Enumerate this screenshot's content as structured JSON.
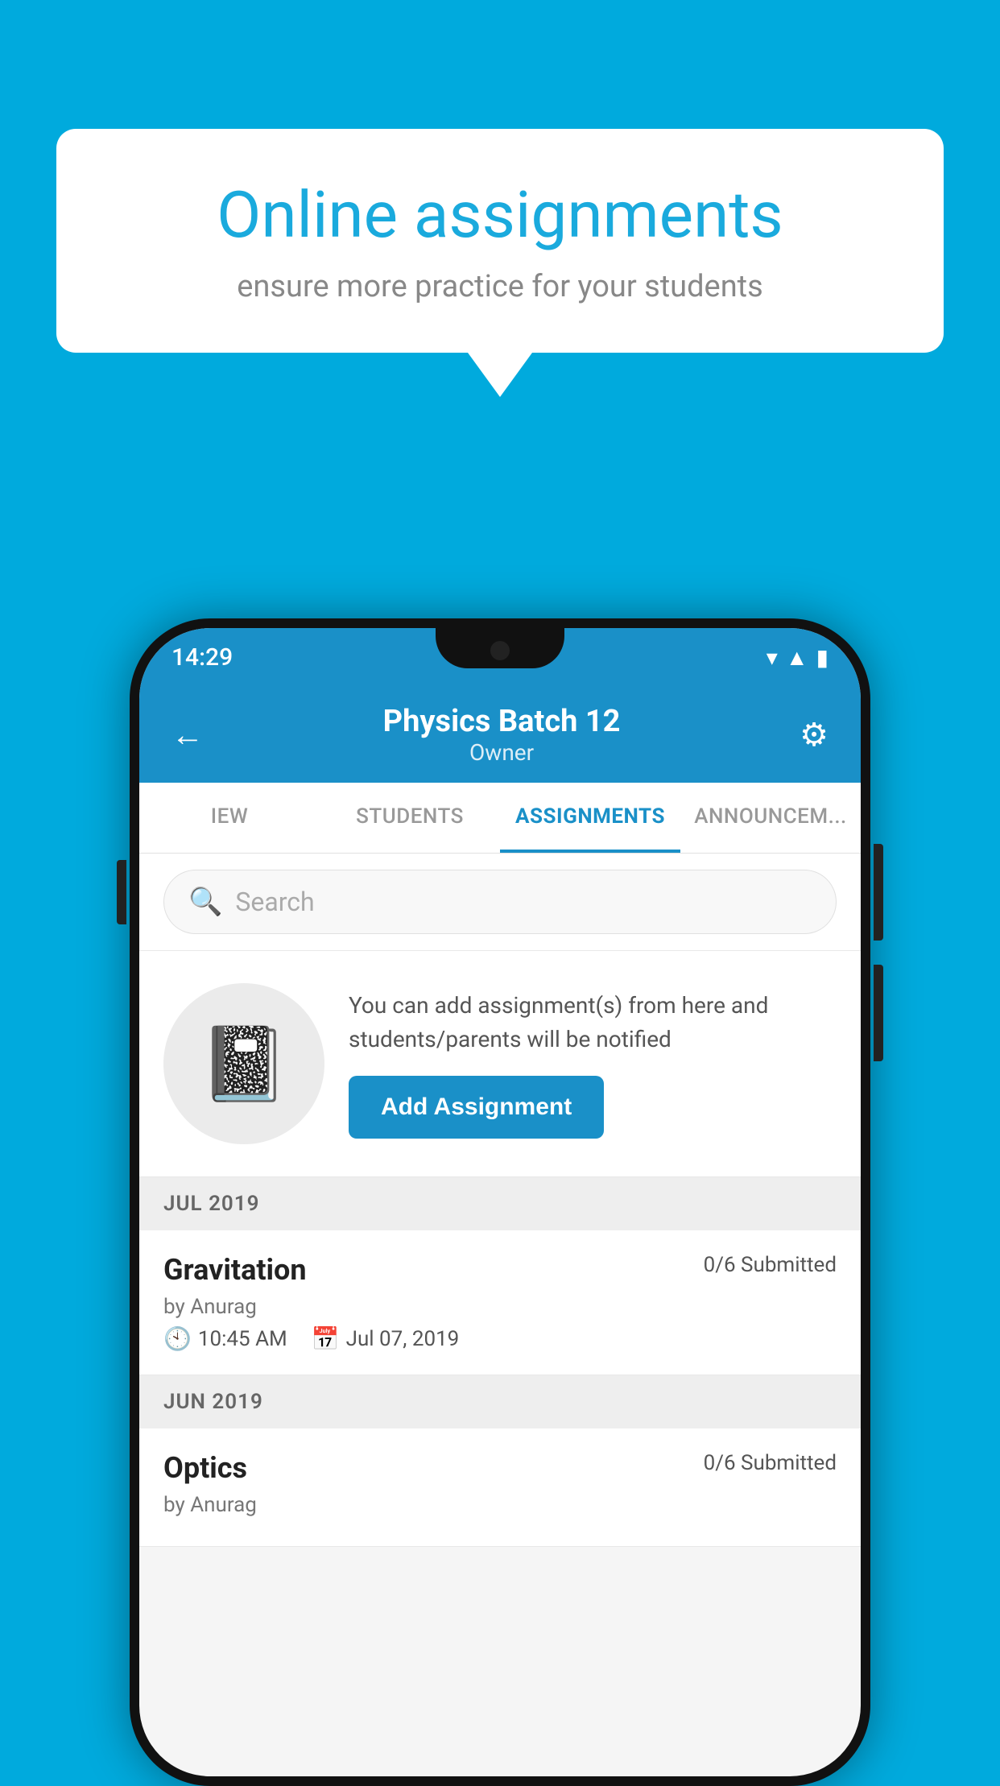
{
  "background_color": "#00AADD",
  "speech_bubble": {
    "title": "Online assignments",
    "subtitle": "ensure more practice for your students"
  },
  "status_bar": {
    "time": "14:29"
  },
  "app_header": {
    "title": "Physics Batch 12",
    "subtitle": "Owner",
    "back_label": "←",
    "settings_label": "⚙"
  },
  "tabs": [
    {
      "label": "IEW",
      "active": false
    },
    {
      "label": "STUDENTS",
      "active": false
    },
    {
      "label": "ASSIGNMENTS",
      "active": true
    },
    {
      "label": "ANNOUNCEM...",
      "active": false
    }
  ],
  "search": {
    "placeholder": "Search"
  },
  "add_assignment_section": {
    "description": "You can add assignment(s) from here and students/parents will be notified",
    "button_label": "Add Assignment"
  },
  "sections": [
    {
      "header": "JUL 2019",
      "assignments": [
        {
          "name": "Gravitation",
          "submitted": "0/6 Submitted",
          "author": "by Anurag",
          "time": "10:45 AM",
          "date": "Jul 07, 2019"
        }
      ]
    },
    {
      "header": "JUN 2019",
      "assignments": [
        {
          "name": "Optics",
          "submitted": "0/6 Submitted",
          "author": "by Anurag",
          "time": "",
          "date": ""
        }
      ]
    }
  ]
}
